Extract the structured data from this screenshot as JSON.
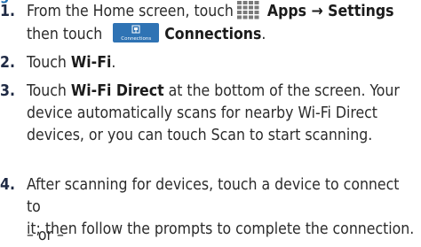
{
  "header_fragment": "g",
  "steps": [
    {
      "number": "1.",
      "line1_pre": "From the Home screen, touch",
      "line1_bold": "Apps → Settings",
      "line2_pre": "then touch",
      "connections_icon_label": "Connections",
      "line2_bold": "Connections",
      "line2_post": "."
    },
    {
      "number": "2.",
      "pre": "Touch ",
      "bold": "Wi-Fi",
      "post": "."
    },
    {
      "number": "3.",
      "pre": "Touch ",
      "bold": "Wi-Fi Direct",
      "line1_post": " at the bottom of the screen. Your",
      "line2": "device automatically scans for nearby Wi-Fi Direct",
      "line3": "devices, or you can touch Scan to start scanning."
    },
    {
      "number": "4.",
      "line1": "After scanning for devices, touch a device to connect to",
      "line2": "it; then follow the prompts to complete the connection."
    }
  ],
  "or_text": "– or –",
  "icons": {
    "apps": "apps-grid-icon",
    "connections": "connections-icon",
    "apps_grid_color": "#7a7a7a",
    "connections_bg": "#2f73b4"
  }
}
